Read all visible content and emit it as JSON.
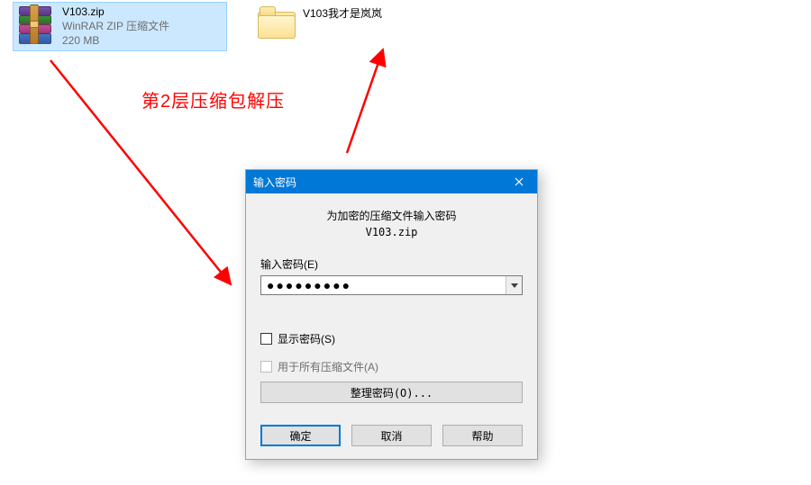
{
  "desktop": {
    "zip": {
      "name": "V103.zip",
      "type_line": "WinRAR ZIP 压缩文件",
      "size": "220 MB"
    },
    "folder": {
      "name": "V103我才是岚岚"
    }
  },
  "annotation": {
    "text": "第2层压缩包解压"
  },
  "dialog": {
    "title": "输入密码",
    "heading_line1": "为加密的压缩文件输入密码",
    "heading_line2": "V103.zip",
    "field_label": "输入密码(E)",
    "password_mask": "●●●●●●●●●",
    "show_password_label": "显示密码(S)",
    "apply_all_label": "用于所有压缩文件(A)",
    "organize_btn": "整理密码(O)...",
    "ok": "确定",
    "cancel": "取消",
    "help": "帮助"
  }
}
